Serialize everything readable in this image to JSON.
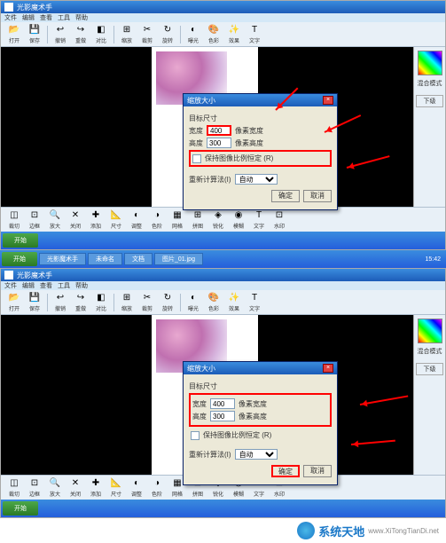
{
  "app": {
    "title": "光影魔术手",
    "menu": [
      "文件",
      "编辑",
      "查看",
      "工具",
      "帮助"
    ]
  },
  "main_toolbar": [
    {
      "icon": "📂",
      "label": "打开"
    },
    {
      "icon": "💾",
      "label": "保存"
    },
    {
      "icon": "↩",
      "label": "撤销"
    },
    {
      "icon": "↪",
      "label": "重做"
    },
    {
      "icon": "◧",
      "label": "对比"
    },
    {
      "icon": "⊞",
      "label": "缩放"
    },
    {
      "icon": "✂",
      "label": "裁剪"
    },
    {
      "icon": "↻",
      "label": "旋转"
    },
    {
      "icon": "◐",
      "label": "曝光"
    },
    {
      "icon": "🎨",
      "label": "色彩"
    },
    {
      "icon": "✨",
      "label": "效果"
    },
    {
      "icon": "T",
      "label": "文字"
    }
  ],
  "bottom_toolbar": [
    {
      "icon": "◫",
      "label": "裁切"
    },
    {
      "icon": "⊡",
      "label": "边框"
    },
    {
      "icon": "🔍",
      "label": "放大"
    },
    {
      "icon": "✕",
      "label": "关闭"
    },
    {
      "icon": "✚",
      "label": "添加"
    },
    {
      "icon": "📐",
      "label": "尺寸"
    },
    {
      "icon": "◐",
      "label": "调整"
    },
    {
      "icon": "◑",
      "label": "色阶"
    },
    {
      "icon": "▦",
      "label": "网格"
    },
    {
      "icon": "⊞",
      "label": "拼图"
    },
    {
      "icon": "◈",
      "label": "锐化"
    },
    {
      "icon": "◉",
      "label": "模糊"
    },
    {
      "icon": "T",
      "label": "文字"
    },
    {
      "icon": "⊡",
      "label": "水印"
    }
  ],
  "right_panel": {
    "mode_label": "混合模式",
    "button_label": "下级"
  },
  "dialog": {
    "title": "缩放大小",
    "group_label": "目标尺寸",
    "width_label": "宽度",
    "height_label": "高度",
    "width_value": "400",
    "height_value": "300",
    "px_label": "像素宽度",
    "px2_label": "像素高度",
    "lock_ratio_label": "保持图像比例恒定 (R)",
    "method_label": "重新计算法(I)",
    "method_value": "自动",
    "ok_label": "确定",
    "cancel_label": "取消"
  },
  "taskbar": {
    "start": "开始",
    "items": [
      "光影魔术手",
      "未命名",
      "文档",
      "图片_01.jpg"
    ],
    "time": "15:42"
  },
  "watermark": {
    "brand": "系统天地",
    "url": "www.XiTongTianDi.net"
  }
}
